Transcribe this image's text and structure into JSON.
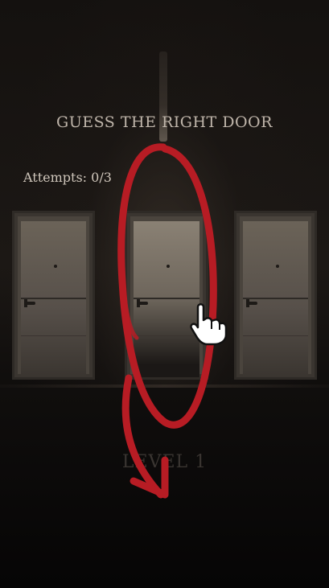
{
  "game": {
    "title": "GUESS THE RIGHT DOOR",
    "attempts_label": "Attempts: 0/3",
    "level_label": "LEVEL 1"
  },
  "doors": [
    {
      "name": "left"
    },
    {
      "name": "middle",
      "highlighted": true
    },
    {
      "name": "right"
    }
  ],
  "hint": {
    "icon": "pointing-hand-icon",
    "overlay": "red-circle-arrow",
    "color": "#b71c24"
  }
}
